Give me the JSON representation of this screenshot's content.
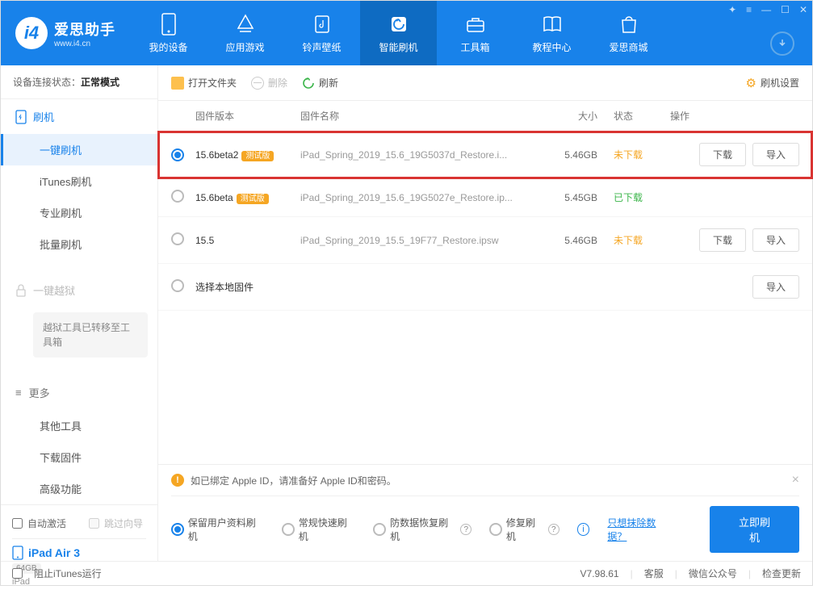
{
  "header": {
    "logo_title": "爱思助手",
    "logo_url": "www.i4.cn",
    "tabs": [
      {
        "label": "我的设备"
      },
      {
        "label": "应用游戏"
      },
      {
        "label": "铃声壁纸"
      },
      {
        "label": "智能刷机"
      },
      {
        "label": "工具箱"
      },
      {
        "label": "教程中心"
      },
      {
        "label": "爱思商城"
      }
    ]
  },
  "sidebar": {
    "conn_label": "设备连接状态：",
    "conn_value": "正常模式",
    "flash_header": "刷机",
    "flash_items": [
      "一键刷机",
      "iTunes刷机",
      "专业刷机",
      "批量刷机"
    ],
    "jailbreak_header": "一键越狱",
    "jailbreak_note": "越狱工具已转移至工具箱",
    "more_header": "更多",
    "more_items": [
      "其他工具",
      "下载固件",
      "高级功能"
    ],
    "auto_activate": "自动激活",
    "skip_guide": "跳过向导",
    "device_name": "iPad Air 3",
    "device_storage": "64GB",
    "device_type": "iPad"
  },
  "toolbar": {
    "open_folder": "打开文件夹",
    "delete": "删除",
    "refresh": "刷新",
    "settings": "刷机设置"
  },
  "table": {
    "headers": {
      "version": "固件版本",
      "name": "固件名称",
      "size": "大小",
      "status": "状态",
      "actions": "操作"
    },
    "rows": [
      {
        "version": "15.6beta2",
        "beta": "测试版",
        "name": "iPad_Spring_2019_15.6_19G5037d_Restore.i...",
        "size": "5.46GB",
        "status": "未下载",
        "status_class": "orange",
        "selected": true,
        "download_btn": "下载",
        "import_btn": "导入",
        "highlighted": true
      },
      {
        "version": "15.6beta",
        "beta": "测试版",
        "name": "iPad_Spring_2019_15.6_19G5027e_Restore.ip...",
        "size": "5.45GB",
        "status": "已下载",
        "status_class": "green",
        "selected": false
      },
      {
        "version": "15.5",
        "beta": "",
        "name": "iPad_Spring_2019_15.5_19F77_Restore.ipsw",
        "size": "5.46GB",
        "status": "未下载",
        "status_class": "orange",
        "selected": false,
        "download_btn": "下载",
        "import_btn": "导入"
      },
      {
        "version": "选择本地固件",
        "beta": "",
        "name": "",
        "size": "",
        "status": "",
        "selected": false,
        "import_btn": "导入"
      }
    ]
  },
  "alert": {
    "text": "如已绑定 Apple ID，请准备好 Apple ID和密码。"
  },
  "options": {
    "opt1": "保留用户资料刷机",
    "opt2": "常规快速刷机",
    "opt3": "防数据恢复刷机",
    "opt4": "修复刷机",
    "erase_link": "只想抹除数据？",
    "flash_btn": "立即刷机"
  },
  "footer": {
    "block_itunes": "阻止iTunes运行",
    "version": "V7.98.61",
    "support": "客服",
    "wechat": "微信公众号",
    "update": "检查更新"
  }
}
